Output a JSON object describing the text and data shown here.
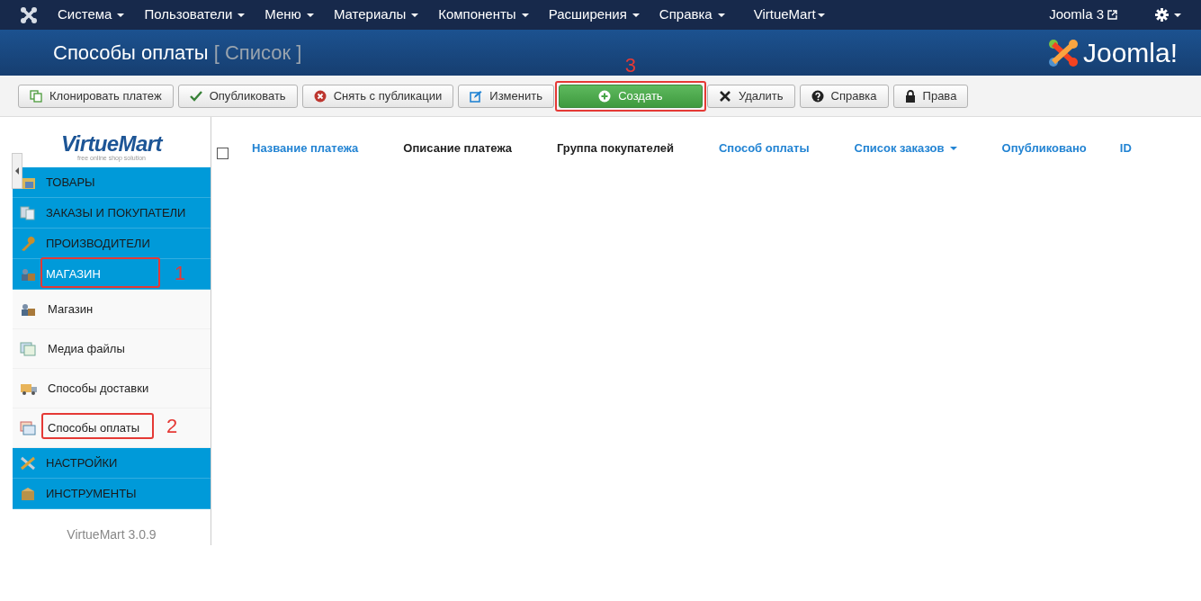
{
  "topnav": {
    "menus": [
      {
        "label": "Система",
        "dropdown": true
      },
      {
        "label": "Пользователи",
        "dropdown": true
      },
      {
        "label": "Меню",
        "dropdown": true
      },
      {
        "label": "Материалы",
        "dropdown": true
      },
      {
        "label": "Компоненты",
        "dropdown": true
      },
      {
        "label": "Расширения",
        "dropdown": true
      },
      {
        "label": "Справка",
        "dropdown": true
      },
      {
        "label": "VirtueMart",
        "dropdown": true
      }
    ],
    "site_link": "Joomla 3"
  },
  "header": {
    "title": "Способы оплаты",
    "subtitle": "[ Список ]",
    "logo": "Joomla!"
  },
  "toolbar": [
    {
      "label": "Клонировать платеж",
      "kind": "copy",
      "primary": false
    },
    {
      "label": "Опубликовать",
      "kind": "check",
      "primary": false
    },
    {
      "label": "Снять с публикации",
      "kind": "unpublish",
      "primary": false
    },
    {
      "label": "Изменить",
      "kind": "edit",
      "primary": false
    },
    {
      "label": "Создать",
      "kind": "plus",
      "primary": true,
      "callout": "3"
    },
    {
      "label": "Удалить",
      "kind": "delete",
      "primary": false
    },
    {
      "label": "Справка",
      "kind": "help",
      "primary": false
    },
    {
      "label": "Права",
      "kind": "lock",
      "primary": false
    }
  ],
  "sidebar": {
    "logo": "VirtueMart",
    "logo_tagline": "free online shop solution",
    "sections": [
      {
        "label": "ТОВАРЫ",
        "kind": "products",
        "selected": false
      },
      {
        "label": "ЗАКАЗЫ И ПОКУПАТЕЛИ",
        "kind": "orders",
        "selected": false
      },
      {
        "label": "ПРОИЗВОДИТЕЛИ",
        "kind": "wrench",
        "selected": false
      },
      {
        "label": "МАГАЗИН",
        "kind": "shop",
        "selected": true,
        "callout": "1",
        "children": [
          {
            "label": "Магазин",
            "kind": "shop"
          },
          {
            "label": "Медиа файлы",
            "kind": "media"
          },
          {
            "label": "Способы доставки",
            "kind": "truck"
          },
          {
            "label": "Способы оплаты",
            "kind": "payment",
            "callout": "2"
          }
        ]
      },
      {
        "label": "НАСТРОЙКИ",
        "kind": "tools",
        "selected": false
      },
      {
        "label": "ИНСТРУМЕНТЫ",
        "kind": "box",
        "selected": false
      }
    ],
    "version": "VirtueMart 3.0.9"
  },
  "table": {
    "select_all_checked": false,
    "columns": [
      {
        "label": "Название платежа",
        "sortable": true,
        "sorted": false
      },
      {
        "label": "Описание платежа",
        "sortable": false,
        "sorted": false
      },
      {
        "label": "Группа покупателей",
        "sortable": false,
        "sorted": false
      },
      {
        "label": "Способ оплаты",
        "sortable": true,
        "sorted": false
      },
      {
        "label": "Список заказов",
        "sortable": true,
        "sorted": true
      },
      {
        "label": "Опубликовано",
        "sortable": true,
        "sorted": false
      },
      {
        "label": "ID",
        "sortable": true,
        "sorted": false
      }
    ]
  }
}
